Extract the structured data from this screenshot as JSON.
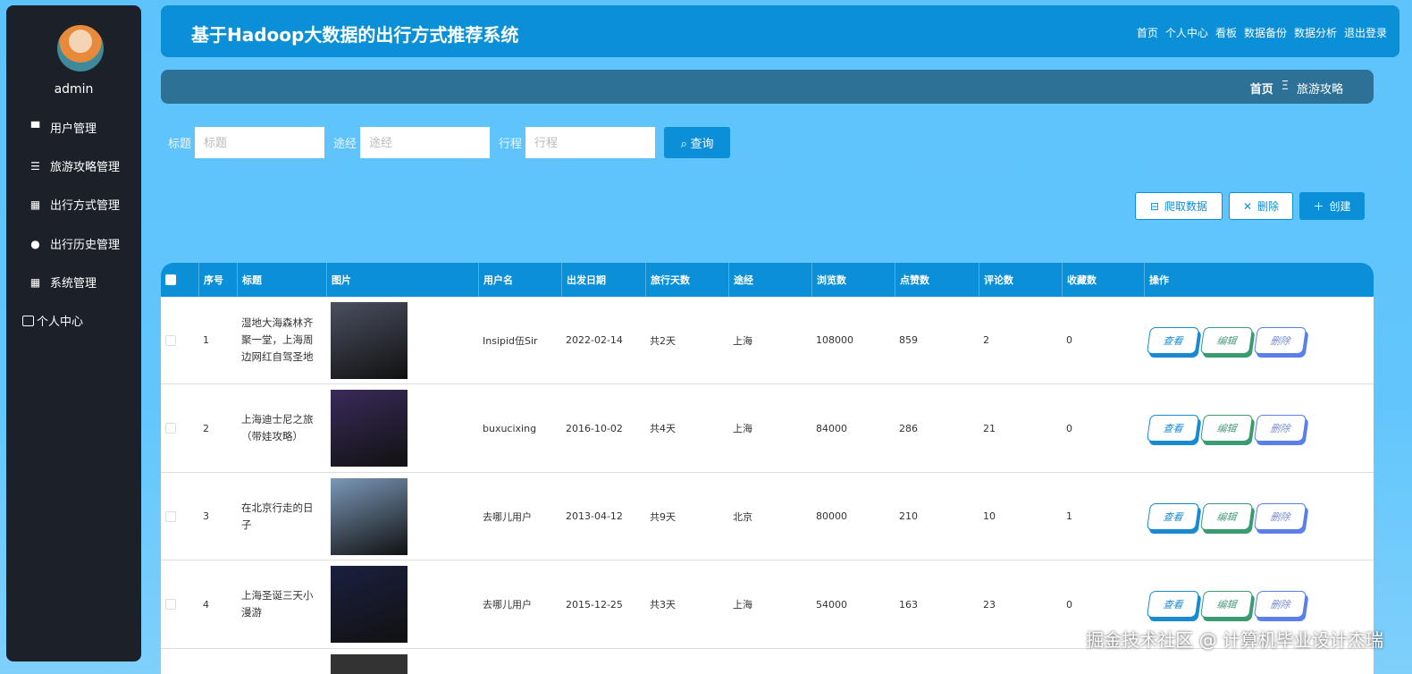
{
  "sidebar": {
    "username": "admin",
    "items": [
      {
        "label": "用户管理",
        "icon": "monitor-icon"
      },
      {
        "label": "旅游攻略管理",
        "icon": "list-icon"
      },
      {
        "label": "出行方式管理",
        "icon": "grid-icon"
      },
      {
        "label": "出行历史管理",
        "icon": "user-icon"
      },
      {
        "label": "系统管理",
        "icon": "grid-icon"
      },
      {
        "label": "个人中心",
        "icon": "wallet-icon"
      }
    ]
  },
  "header": {
    "title": "基于Hadoop大数据的出行方式推荐系统",
    "nav": [
      "首页",
      "个人中心",
      "看板",
      "数据备份",
      "数据分析",
      "退出登录"
    ]
  },
  "breadcrumb": {
    "home": "首页",
    "sep": "Ξ",
    "current": "旅游攻略"
  },
  "search": {
    "fields": [
      {
        "label": "标题",
        "placeholder": "标题"
      },
      {
        "label": "途经",
        "placeholder": "途经"
      },
      {
        "label": "行程",
        "placeholder": "行程"
      }
    ],
    "button": "查询"
  },
  "actions": {
    "crawl": "爬取数据",
    "delete": "删除",
    "create": "创建"
  },
  "table": {
    "columns": [
      "序号",
      "标题",
      "图片",
      "用户名",
      "出发日期",
      "旅行天数",
      "途经",
      "浏览数",
      "点赞数",
      "评论数",
      "收藏数",
      "操作"
    ],
    "rows": [
      {
        "no": "1",
        "title": "湿地大海森林齐聚一堂，上海周边网红自驾圣地",
        "user": "Insipid伍Sir",
        "date": "2022-02-14",
        "days": "共2天",
        "via": "上海",
        "views": "108000",
        "likes": "859",
        "comments": "2",
        "favs": "0",
        "img": "#4a5060"
      },
      {
        "no": "2",
        "title": "上海迪士尼之旅（带娃攻略）",
        "user": "buxucixing",
        "date": "2016-10-02",
        "days": "共4天",
        "via": "上海",
        "views": "84000",
        "likes": "286",
        "comments": "21",
        "favs": "0",
        "img": "#3a2a5a"
      },
      {
        "no": "3",
        "title": "在北京行走的日子",
        "user": "去哪儿用户",
        "date": "2013-04-12",
        "days": "共9天",
        "via": "北京",
        "views": "80000",
        "likes": "210",
        "comments": "10",
        "favs": "1",
        "img": "#7a98b8"
      },
      {
        "no": "4",
        "title": "上海圣诞三天小漫游",
        "user": "去哪儿用户",
        "date": "2015-12-25",
        "days": "共3天",
        "via": "上海",
        "views": "54000",
        "likes": "163",
        "comments": "23",
        "favs": "0",
        "img": "#1a2040"
      }
    ],
    "ops": {
      "view": "查看",
      "edit": "编辑",
      "delete": "删除"
    }
  },
  "watermark": "掘金技术社区 @ 计算机毕业设计杰瑞"
}
